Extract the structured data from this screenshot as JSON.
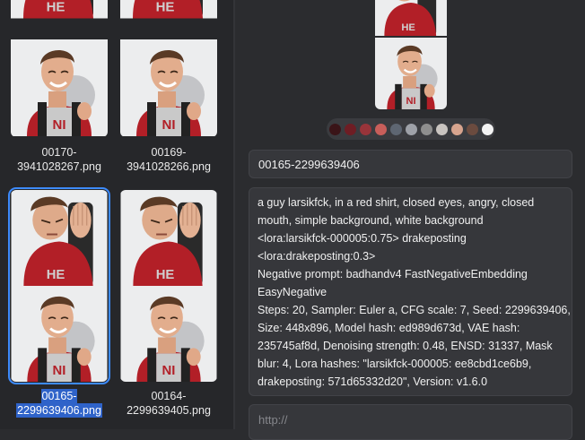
{
  "gallery": {
    "items": [
      {
        "caption_line1": "00170-",
        "caption_line2": "3941028267.png"
      },
      {
        "caption_line1": "00169-",
        "caption_line2": "3941028266.png"
      },
      {
        "caption_line1": "00165-",
        "caption_line2": "2299639406.png",
        "selected": true
      },
      {
        "caption_line1": "00164-",
        "caption_line2": "2299639405.png"
      }
    ]
  },
  "detail": {
    "palette": [
      "#3a1418",
      "#6e1d24",
      "#98343a",
      "#c85e5a",
      "#5e6672",
      "#9ea1a8",
      "#8e8e8e",
      "#c9c4c0",
      "#d7a48e",
      "#6b4b3f",
      "#f3f3f3"
    ],
    "filename": "00165-2299639406",
    "prompt_lines": [
      "a guy larsikfck, in a red shirt, closed eyes, angry, closed",
      "mouth, simple background, white background",
      "<lora:larsikfck-000005:0.75> drakeposting",
      "<lora:drakeposting:0.3>",
      "Negative prompt:  badhandv4 FastNegativeEmbedding",
      "EasyNegative",
      "Steps: 20, Sampler: Euler a, CFG scale: 7, Seed: 2299639406,",
      "Size: 448x896, Model hash: ed989d673d, VAE hash:",
      "235745af8d, Denoising strength: 0.48, ENSD: 31337, Mask",
      "blur: 4, Lora hashes: \"larsikfck-000005: ee8cbd1ce6b9,",
      "drakeposting: 571d65332d20\", Version: v1.6.0"
    ],
    "url_placeholder": "http://"
  }
}
